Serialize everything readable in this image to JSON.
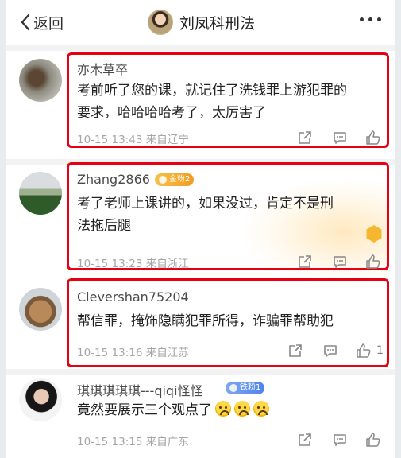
{
  "header": {
    "back_label": "返回",
    "title": "刘凤科刑法"
  },
  "comments": [
    {
      "user": "亦木草卒",
      "text_line1": "考前听了您的课，就记住了洗钱罪上游犯罪的",
      "text_line2": "要求，哈哈哈哈考了，太厉害了",
      "time": "10-15 13:43",
      "location": "来自辽宁",
      "likes": ""
    },
    {
      "user": "Zhang2866",
      "badge": "金粉2",
      "text_line1": "考了老师上课讲的，如果没过，肯定不是刑",
      "text_line2": "法拖后腿",
      "time": "10-15 13:23",
      "location": "来自浙江",
      "likes": ""
    },
    {
      "user": "Clevershan75204",
      "text_line1": "帮信罪，掩饰隐瞒犯罪所得，诈骗罪帮助犯",
      "time": "10-15 13:16",
      "location": "来自江苏",
      "likes": "1"
    },
    {
      "user": "琪琪琪琪琪---qiqi怪怪",
      "badge": "铁粉1",
      "text_line1": "竟然要展示三个观点了",
      "emoji": "crying-face",
      "time": "10-15 13:15",
      "location": "来自广东",
      "likes": ""
    }
  ],
  "colors": {
    "highlight": "#e60012",
    "gold_badge": "#f19c1f",
    "iron_badge": "#4f84ea",
    "meta": "#a6a6a6"
  }
}
